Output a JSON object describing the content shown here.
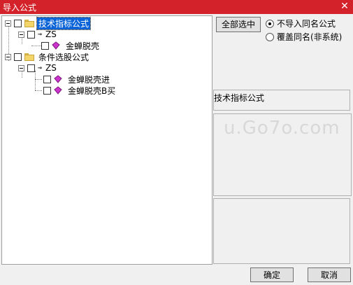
{
  "window": {
    "title": "导入公式",
    "close_icon": "close-icon"
  },
  "tree": {
    "nodes": [
      {
        "label": "技术指标公式",
        "type": "folder",
        "selected": true
      },
      {
        "label": "ZS",
        "type": "key"
      },
      {
        "label": "金蝉脱壳",
        "type": "formula"
      },
      {
        "label": "条件选股公式",
        "type": "folder",
        "selected": false
      },
      {
        "label": "ZS",
        "type": "key"
      },
      {
        "label": "金蝉脱壳进",
        "type": "formula"
      },
      {
        "label": "金蝉脱壳B买",
        "type": "formula"
      }
    ]
  },
  "buttons": {
    "select_all": "全部选中",
    "ok": "确定",
    "cancel": "取消"
  },
  "options": {
    "no_import_same_name": "不导入同名公式",
    "overwrite_same_name": "覆盖同名(非系统)",
    "selected": "no_import_same_name"
  },
  "info": {
    "category": "技术指标公式"
  },
  "watermark": {
    "text": "u.Go7o.com"
  },
  "colors": {
    "titlebar": "#d4222a",
    "selection": "#0a64d8",
    "gem": "#cc33cc"
  }
}
